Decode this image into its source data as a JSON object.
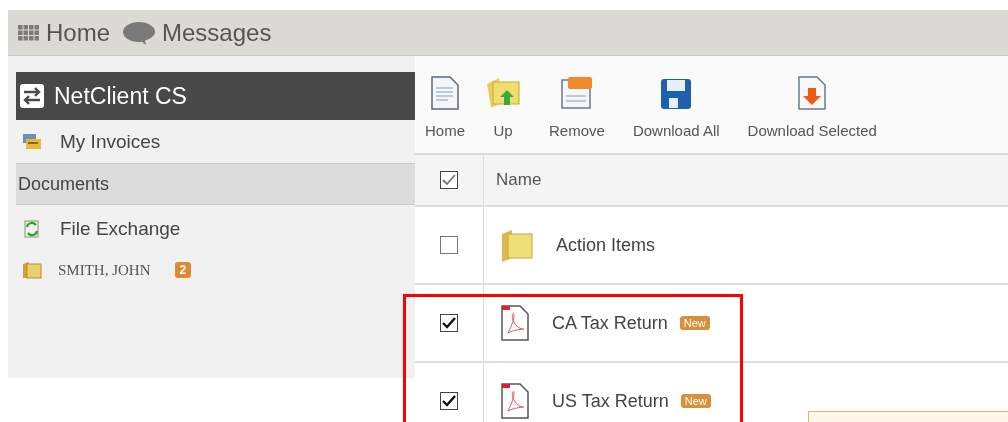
{
  "top_nav": [
    {
      "kind": "grid",
      "label": "Home"
    },
    {
      "kind": "chat",
      "label": "Messages"
    }
  ],
  "sidebar": {
    "title": "NetClient CS",
    "items": [
      {
        "kind": "invoices",
        "label": "My Invoices"
      },
      {
        "kind": "section",
        "label": "Documents"
      },
      {
        "kind": "exchange",
        "label": "File Exchange"
      },
      {
        "kind": "folder",
        "label": "SMITH, JOHN",
        "badge": "2"
      }
    ]
  },
  "toolbar": [
    {
      "kind": "home",
      "label": "Home"
    },
    {
      "kind": "up",
      "label": "Up"
    },
    {
      "kind": "remove",
      "label": "Remove"
    },
    {
      "kind": "download_all",
      "label": "Download All"
    },
    {
      "kind": "download_selected",
      "label": "Download Selected"
    }
  ],
  "table": {
    "header": {
      "checked": true,
      "label": "Name"
    },
    "rows": [
      {
        "kind": "folder",
        "name": "Action Items",
        "checked": false
      },
      {
        "kind": "pdf",
        "name": "CA Tax Return",
        "checked": true,
        "badge": "New"
      },
      {
        "kind": "pdf",
        "name": "US Tax Return",
        "checked": true,
        "badge": "New"
      }
    ]
  }
}
